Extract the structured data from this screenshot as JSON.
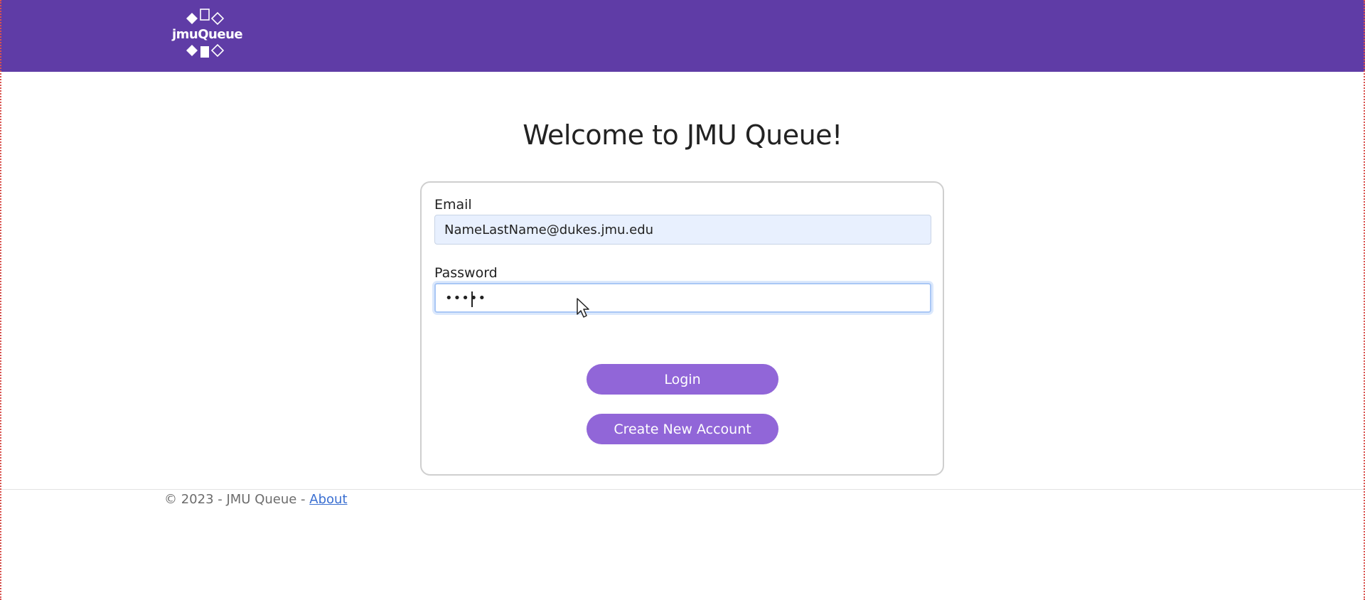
{
  "header": {
    "logo_text": "jmuQueue",
    "background_color": "#5f3ca6"
  },
  "main": {
    "title": "Welcome to JMU Queue!"
  },
  "login_form": {
    "email_label": "Email",
    "email_value": "NameLastName@dukes.jmu.edu",
    "password_label": "Password",
    "password_value": "•••••",
    "login_button": "Login",
    "create_account_button": "Create New Account",
    "button_color": "#9166d8"
  },
  "footer": {
    "copyright": "© 2023 - JMU Queue - ",
    "about_link": "About"
  },
  "icons": {
    "logo": "jmuqueue-logo-icon",
    "pointer": "mouse-pointer-icon"
  }
}
